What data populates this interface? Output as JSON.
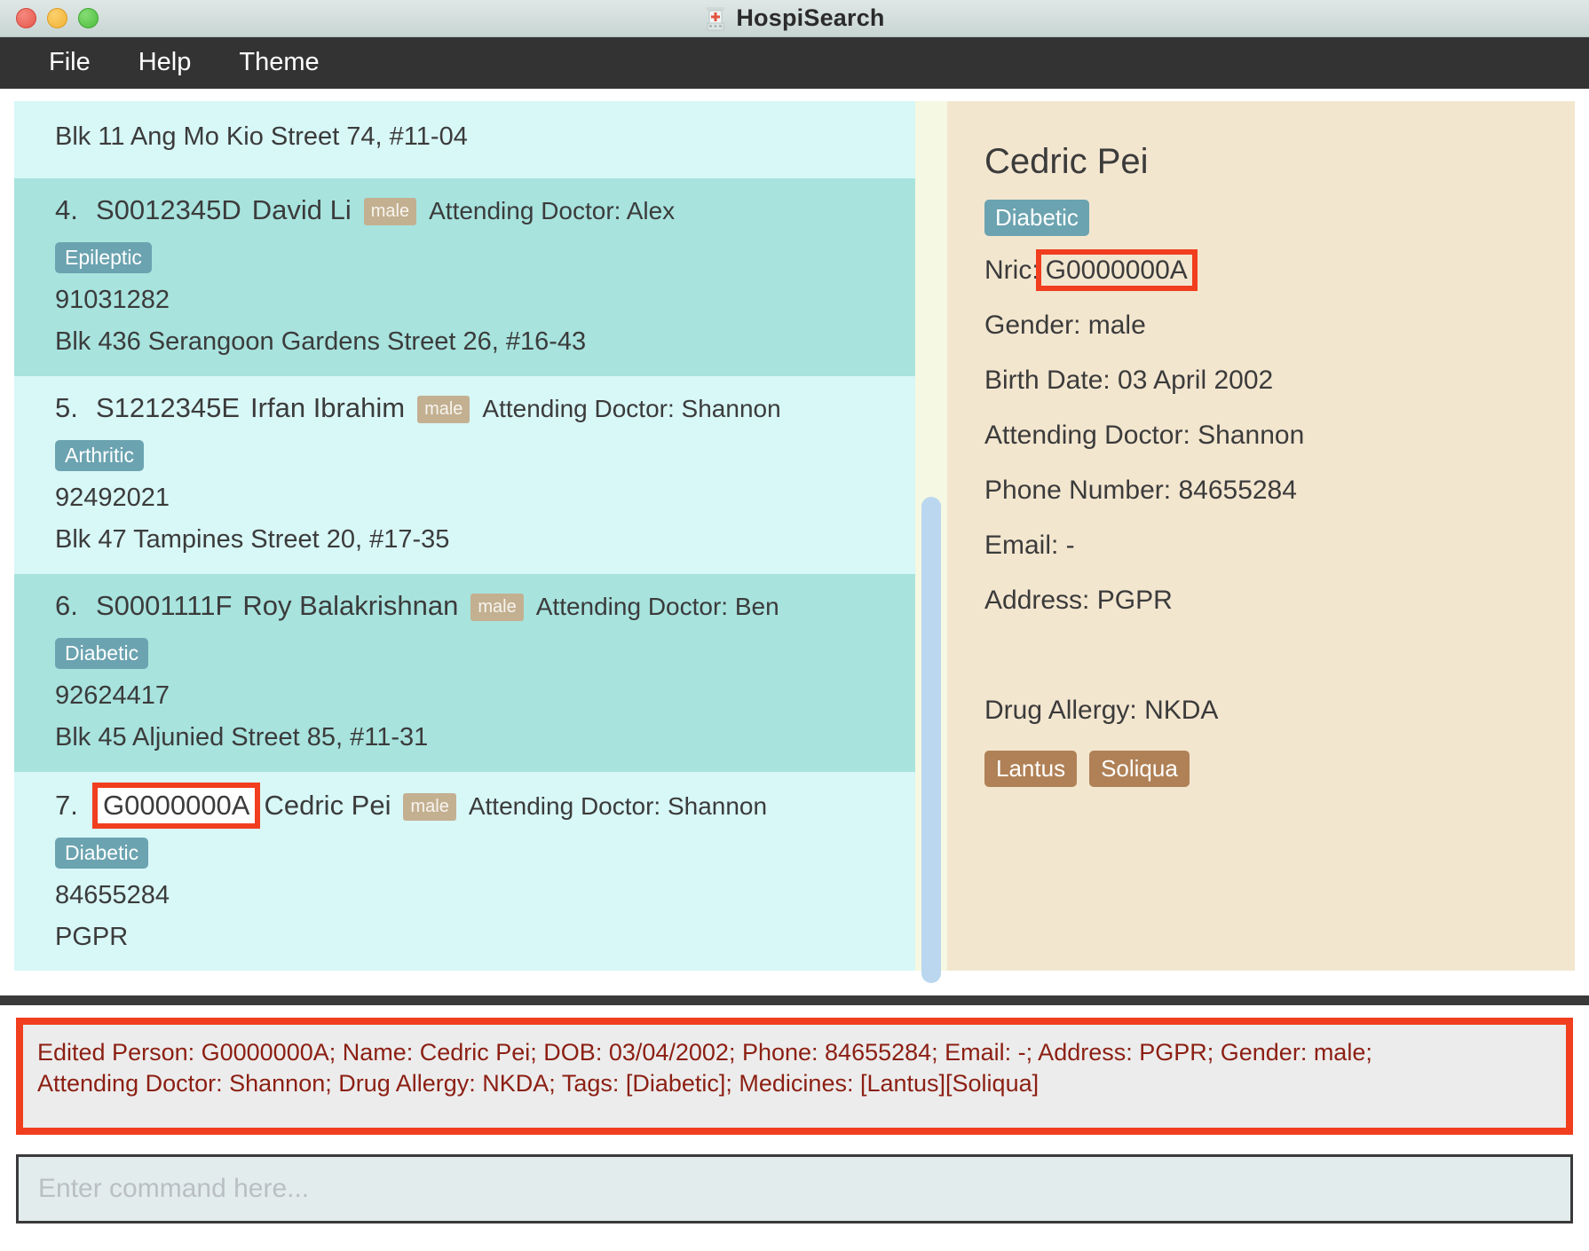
{
  "window": {
    "title": "HospiSearch",
    "app_icon": "hospital-icon",
    "traffic_lights": [
      {
        "name": "close",
        "color": "#e8564a"
      },
      {
        "name": "minimize",
        "color": "#f2b233"
      },
      {
        "name": "zoom",
        "color": "#4dbd3e"
      }
    ]
  },
  "menubar": {
    "items": [
      {
        "label": "File",
        "name": "menu-file"
      },
      {
        "label": "Help",
        "name": "menu-help"
      },
      {
        "label": "Theme",
        "name": "menu-theme"
      }
    ]
  },
  "list": {
    "partial_top": {
      "address": "Blk 11 Ang Mo Kio Street 74, #11-04"
    },
    "items": [
      {
        "index": "4.",
        "nric": "S0012345D",
        "name": "David Li",
        "gender": "male",
        "doctor_label": "Attending Doctor: Alex",
        "tag": "Epileptic",
        "phone": "91031282",
        "address": "Blk 436 Serangoon Gardens Street 26, #16-43",
        "highlighted": false
      },
      {
        "index": "5.",
        "nric": "S1212345E",
        "name": "Irfan Ibrahim",
        "gender": "male",
        "doctor_label": "Attending Doctor: Shannon",
        "tag": "Arthritic",
        "phone": "92492021",
        "address": "Blk 47 Tampines Street 20, #17-35",
        "highlighted": false
      },
      {
        "index": "6.",
        "nric": "S0001111F",
        "name": "Roy Balakrishnan",
        "gender": "male",
        "doctor_label": "Attending Doctor: Ben",
        "tag": "Diabetic",
        "phone": "92624417",
        "address": "Blk 45 Aljunied Street 85, #11-31",
        "highlighted": false
      },
      {
        "index": "7.",
        "nric": "G0000000A",
        "name": "Cedric Pei",
        "gender": "male",
        "doctor_label": "Attending Doctor: Shannon",
        "tag": "Diabetic",
        "phone": "84655284",
        "address": "PGPR",
        "highlighted": true
      }
    ]
  },
  "detail": {
    "name": "Cedric Pei",
    "tag": "Diabetic",
    "nric_label": "Nric:",
    "nric_value": "G0000000A",
    "gender": "Gender: male",
    "birth_date": "Birth Date: 03 April 2002",
    "doctor": "Attending Doctor: Shannon",
    "phone": "Phone Number: 84655284",
    "email": "Email: -",
    "address": "Address: PGPR",
    "drug_allergy": "Drug Allergy: NKDA",
    "medicines": [
      "Lantus",
      "Soliqua"
    ]
  },
  "result": {
    "line1": "Edited Person: G0000000A; Name: Cedric Pei; DOB: 03/04/2002; Phone: 84655284; Email: -; Address: PGPR; Gender: male;",
    "line2": "Attending Doctor: Shannon; Drug Allergy: NKDA; Tags: [Diabetic]; Medicines: [Lantus][Soliqua]"
  },
  "command": {
    "placeholder": "Enter command here...",
    "value": ""
  },
  "colors": {
    "accent_red": "#f03e1e",
    "tag_blue": "#6ba3b0",
    "med_brown": "#b08156",
    "gender_tan": "#c3b091",
    "list_odd": "#d8f7f7",
    "list_even": "#a8e3de",
    "detail_bg": "#f3e6cf",
    "menubar_bg": "#333333"
  }
}
